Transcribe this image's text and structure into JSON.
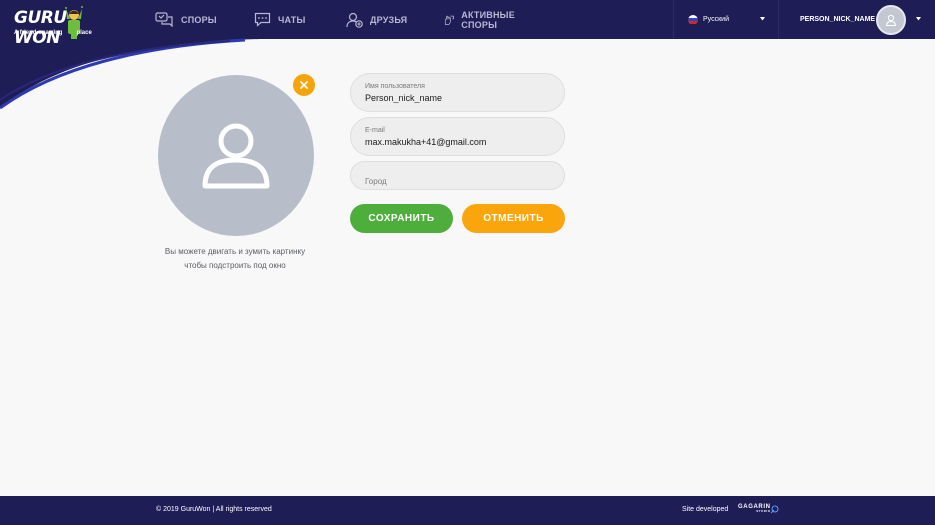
{
  "colors": {
    "header": "#1e1d55",
    "save": "#4eae3c",
    "cancel": "#fba50c",
    "avatar": "#b7bec9"
  },
  "logo": {
    "main_a": "GURU",
    "main_b": "WON",
    "tagline_a": "A friend-sparring",
    "tagline_b": "place"
  },
  "nav": {
    "items": [
      {
        "label": "Споры",
        "icon": "disputes-icon"
      },
      {
        "label": "Чаты",
        "icon": "chat-icon"
      },
      {
        "label": "Друзья",
        "icon": "add-friend-icon"
      },
      {
        "label": "Активные споры",
        "icon": "active-disputes-icon"
      }
    ]
  },
  "language": {
    "selected": "Русский"
  },
  "user": {
    "nickname": "PERSON_NICK_NAME"
  },
  "profile": {
    "hint_line1": "Вы можете двигать и зумить картинку",
    "hint_line2": "чтобы подстроить под окно"
  },
  "form": {
    "username": {
      "label": "Имя пользователя",
      "value": "Person_nick_name"
    },
    "email": {
      "label": "E-mail",
      "value": "max.makukha+41@gmail.com"
    },
    "city": {
      "placeholder": "Город",
      "value": ""
    },
    "save_label": "Сохранить",
    "cancel_label": "Отменить"
  },
  "footer": {
    "copyright": "© 2019 GuruWon  |  All rights reserved",
    "site_developed": "Site developed",
    "studio_name": "GAGARIN",
    "studio_sub": "STUDIO"
  }
}
